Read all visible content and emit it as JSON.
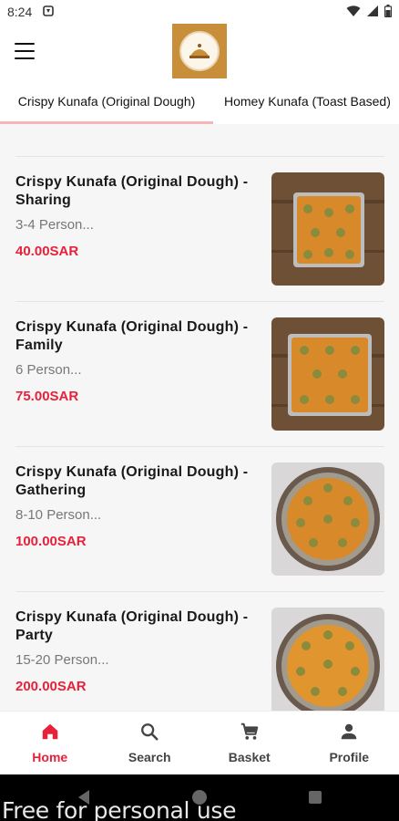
{
  "status_bar": {
    "time": "8:24"
  },
  "tabs": [
    {
      "label": "Crispy Kunafa (Original Dough)",
      "active": true
    },
    {
      "label": "Homey Kunafa (Toast Based)",
      "active": false
    }
  ],
  "items": [
    {
      "title": "Crispy Kunafa (Original Dough) - Sharing",
      "desc": "3-4 Person...",
      "price": "40.00SAR",
      "image": "rect-tray"
    },
    {
      "title": "Crispy Kunafa (Original Dough) - Family",
      "desc": "6 Person...",
      "price": "75.00SAR",
      "image": "rect-tray"
    },
    {
      "title": "Crispy Kunafa (Original Dough) - Gathering",
      "desc": "8-10 Person...",
      "price": "100.00SAR",
      "image": "round-tray"
    },
    {
      "title": "Crispy Kunafa (Original Dough) - Party",
      "desc": "15-20 Person...",
      "price": "200.00SAR",
      "image": "round-tray"
    }
  ],
  "bottom_nav": [
    {
      "label": "Home",
      "icon": "home-icon",
      "active": true
    },
    {
      "label": "Search",
      "icon": "search-icon",
      "active": false
    },
    {
      "label": "Basket",
      "icon": "cart-icon",
      "active": false
    },
    {
      "label": "Profile",
      "icon": "person-icon",
      "active": false
    }
  ],
  "watermark": "Free for personal use",
  "colors": {
    "accent": "#e8213a",
    "tab_indicator": "#f6b5b9",
    "logo_bg": "#c98e3a"
  }
}
